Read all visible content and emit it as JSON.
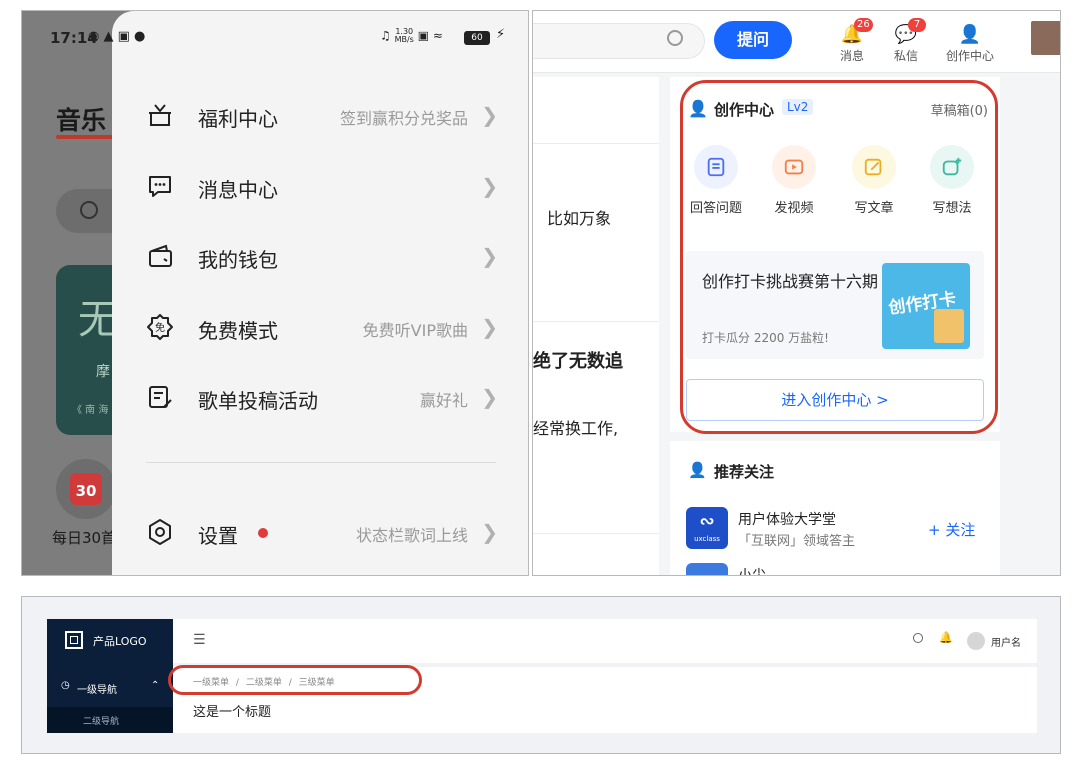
{
  "music_app": {
    "status": {
      "time": "17:14",
      "net_speed_top": "1.30",
      "net_speed_unit": "MB/s",
      "battery": "60"
    },
    "background": {
      "title": "音乐",
      "card_glyph": "无",
      "card_line1": "摩",
      "card_line2": "《 南 海",
      "calendar_day": "30",
      "daily_label": "每日30首"
    },
    "menu": [
      {
        "label": "福利中心",
        "hint": "签到赢积分兑奖品"
      },
      {
        "label": "消息中心",
        "hint": ""
      },
      {
        "label": "我的钱包",
        "hint": ""
      },
      {
        "label": "免费模式",
        "hint": "免费听VIP歌曲"
      },
      {
        "label": "歌单投稿活动",
        "hint": "赢好礼"
      }
    ],
    "settings": {
      "label": "设置",
      "hint": "状态栏歌词上线"
    }
  },
  "qa_site": {
    "ask_button": "提问",
    "nav": [
      {
        "label": "消息",
        "badge": "26"
      },
      {
        "label": "私信",
        "badge": "7"
      },
      {
        "label": "创作中心",
        "badge": ""
      }
    ],
    "feed": {
      "snippet1": "比如万象",
      "snippet2": "绝了无数追",
      "snippet3": "经常换工作,"
    },
    "creator": {
      "title": "创作中心",
      "level": "Lv2",
      "drafts": "草稿箱(0)",
      "actions": [
        {
          "label": "回答问题",
          "icon": "doc-icon",
          "color": "#eef2ff"
        },
        {
          "label": "发视频",
          "icon": "video-icon",
          "color": "#fff1e8"
        },
        {
          "label": "写文章",
          "icon": "pencil-icon",
          "color": "#fff8e0"
        },
        {
          "label": "写想法",
          "icon": "idea-icon",
          "color": "#e8f7f3"
        }
      ],
      "banner_title": "创作打卡挑战赛第十六期",
      "banner_sub": "打卡瓜分 2200 万盐粒!",
      "banner_art": "创作打卡",
      "enter_button": "进入创作中心 >"
    },
    "recommend": {
      "title": "推荐关注",
      "user1_name": "用户体验大学堂",
      "user1_desc": "「互联网」领域答主",
      "user1_logo": "uxclass",
      "follow": "+ 关注",
      "user2_name": "小尖"
    }
  },
  "admin": {
    "logo": "产品LOGO",
    "nav_level1": "一级导航",
    "nav_level2": "二级导航",
    "username": "用户名",
    "breadcrumb": [
      "一级菜单",
      "二级菜单",
      "三级菜单"
    ],
    "breadcrumb_sep": "/",
    "page_title": "这是一个标题"
  }
}
